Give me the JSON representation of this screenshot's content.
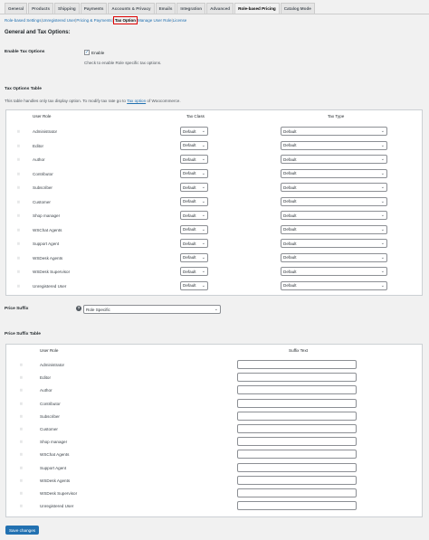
{
  "tabs": [
    "General",
    "Products",
    "Shipping",
    "Payments",
    "Accounts & Privacy",
    "Emails",
    "Integration",
    "Advanced",
    "Role-based Pricing",
    "Catalog Mode"
  ],
  "active_tab_index": 8,
  "subnav": {
    "role_based_settings": "Role-based Settings",
    "unregistered_user": "Unregistered User",
    "pricing_payments": "Pricing & Payments",
    "tax_option": "Tax Option",
    "manage_user_role": "Manage User Role",
    "license": "License",
    "separator": "|"
  },
  "heading": "General and Tax Options:",
  "enable_tax": {
    "label": "Enable Tax Options",
    "checkbox_label": "Enable",
    "checked": true,
    "description": "Check to enable Role specific tax options."
  },
  "tax_table": {
    "title": "Tax Options Table",
    "description_before": "This table handles only tax display option. To modify tax rate go to",
    "link": "Tax option",
    "description_after": "of Woocommerce.",
    "columns": [
      "User Role",
      "Tax Class",
      "Tax Type"
    ],
    "rows": [
      {
        "role": "Administrator",
        "tax_class": "Default",
        "tax_type": "Default"
      },
      {
        "role": "Editor",
        "tax_class": "Default",
        "tax_type": "Default"
      },
      {
        "role": "Author",
        "tax_class": "Default",
        "tax_type": "Default"
      },
      {
        "role": "Contributor",
        "tax_class": "Default",
        "tax_type": "Default"
      },
      {
        "role": "Subscriber",
        "tax_class": "Default",
        "tax_type": "Default"
      },
      {
        "role": "Customer",
        "tax_class": "Default",
        "tax_type": "Default"
      },
      {
        "role": "Shop manager",
        "tax_class": "Default",
        "tax_type": "Default"
      },
      {
        "role": "WSChat Agents",
        "tax_class": "Default",
        "tax_type": "Default"
      },
      {
        "role": "Support Agent",
        "tax_class": "Default",
        "tax_type": "Default"
      },
      {
        "role": "WSDesk Agents",
        "tax_class": "Default",
        "tax_type": "Default"
      },
      {
        "role": "WSDesk Supervisor",
        "tax_class": "Default",
        "tax_type": "Default"
      },
      {
        "role": "Unregistered User",
        "tax_class": "Default",
        "tax_type": "Default"
      }
    ]
  },
  "price_suffix": {
    "label": "Price Suffix",
    "help_icon": "question-icon",
    "value": "Role Specific"
  },
  "suffix_table": {
    "title": "Price Suffix Table",
    "columns": [
      "User Role",
      "Suffix Text"
    ],
    "rows": [
      {
        "role": "Administrator",
        "suffix": ""
      },
      {
        "role": "Editor",
        "suffix": ""
      },
      {
        "role": "Author",
        "suffix": ""
      },
      {
        "role": "Contributor",
        "suffix": ""
      },
      {
        "role": "Subscriber",
        "suffix": ""
      },
      {
        "role": "Customer",
        "suffix": ""
      },
      {
        "role": "Shop manager",
        "suffix": ""
      },
      {
        "role": "WSChat Agents",
        "suffix": ""
      },
      {
        "role": "Support Agent",
        "suffix": ""
      },
      {
        "role": "WSDesk Agents",
        "suffix": ""
      },
      {
        "role": "WSDesk Supervisor",
        "suffix": ""
      },
      {
        "role": "Unregistered User",
        "suffix": ""
      }
    ]
  },
  "save_button": "Save changes",
  "icons": {
    "drag_handle": "drag-handle-icon",
    "chevron": "chevron-down-icon",
    "checkmark": "checkmark-icon"
  },
  "colors": {
    "accent": "#2271b1",
    "highlight_border": "#dd0000",
    "page_bg": "#f1f1f1"
  }
}
